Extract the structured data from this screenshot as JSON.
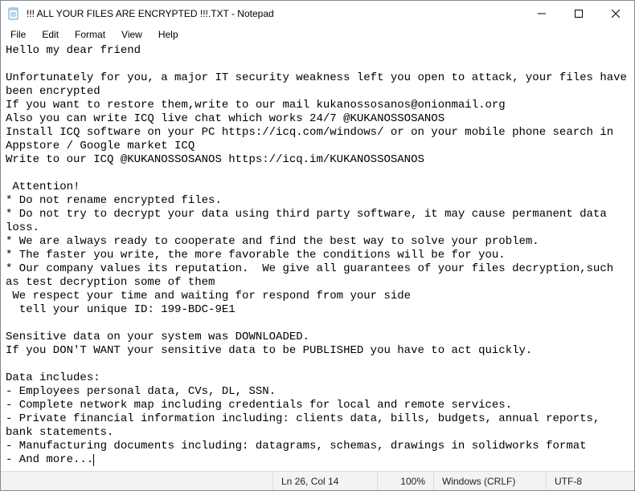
{
  "window": {
    "title": "!!! ALL YOUR FILES ARE ENCRYPTED !!!.TXT - Notepad",
    "app_icon": "notepad-icon"
  },
  "menu": {
    "file": "File",
    "edit": "Edit",
    "format": "Format",
    "view": "View",
    "help": "Help"
  },
  "content": "Hello my dear friend\n\nUnfortunately for you, a major IT security weakness left you open to attack, your files have been encrypted\nIf you want to restore them,write to our mail kukanossosanos@onionmail.org\nAlso you can write ICQ live chat which works 24/7 @KUKANOSSOSANOS\nInstall ICQ software on your PC https://icq.com/windows/ or on your mobile phone search in Appstore / Google market ICQ\nWrite to our ICQ @KUKANOSSOSANOS https://icq.im/KUKANOSSOSANOS\n\n Attention!\n* Do not rename encrypted files.\n* Do not try to decrypt your data using third party software, it may cause permanent data loss.\n* We are always ready to cooperate and find the best way to solve your problem.\n* The faster you write, the more favorable the conditions will be for you.\n* Our company values its reputation.  We give all guarantees of your files decryption,such as test decryption some of them\n We respect your time and waiting for respond from your side\n  tell your unique ID: 199-BDC-9E1\n\nSensitive data on your system was DOWNLOADED.\nIf you DON'T WANT your sensitive data to be PUBLISHED you have to act quickly.\n\nData includes:\n- Employees personal data, CVs, DL, SSN.\n- Complete network map including credentials for local and remote services.\n- Private financial information including: clients data, bills, budgets, annual reports, bank statements.\n- Manufacturing documents including: datagrams, schemas, drawings in solidworks format\n- And more...",
  "statusbar": {
    "position": "Ln 26, Col 14",
    "zoom": "100%",
    "lineending": "Windows (CRLF)",
    "encoding": "UTF-8"
  }
}
